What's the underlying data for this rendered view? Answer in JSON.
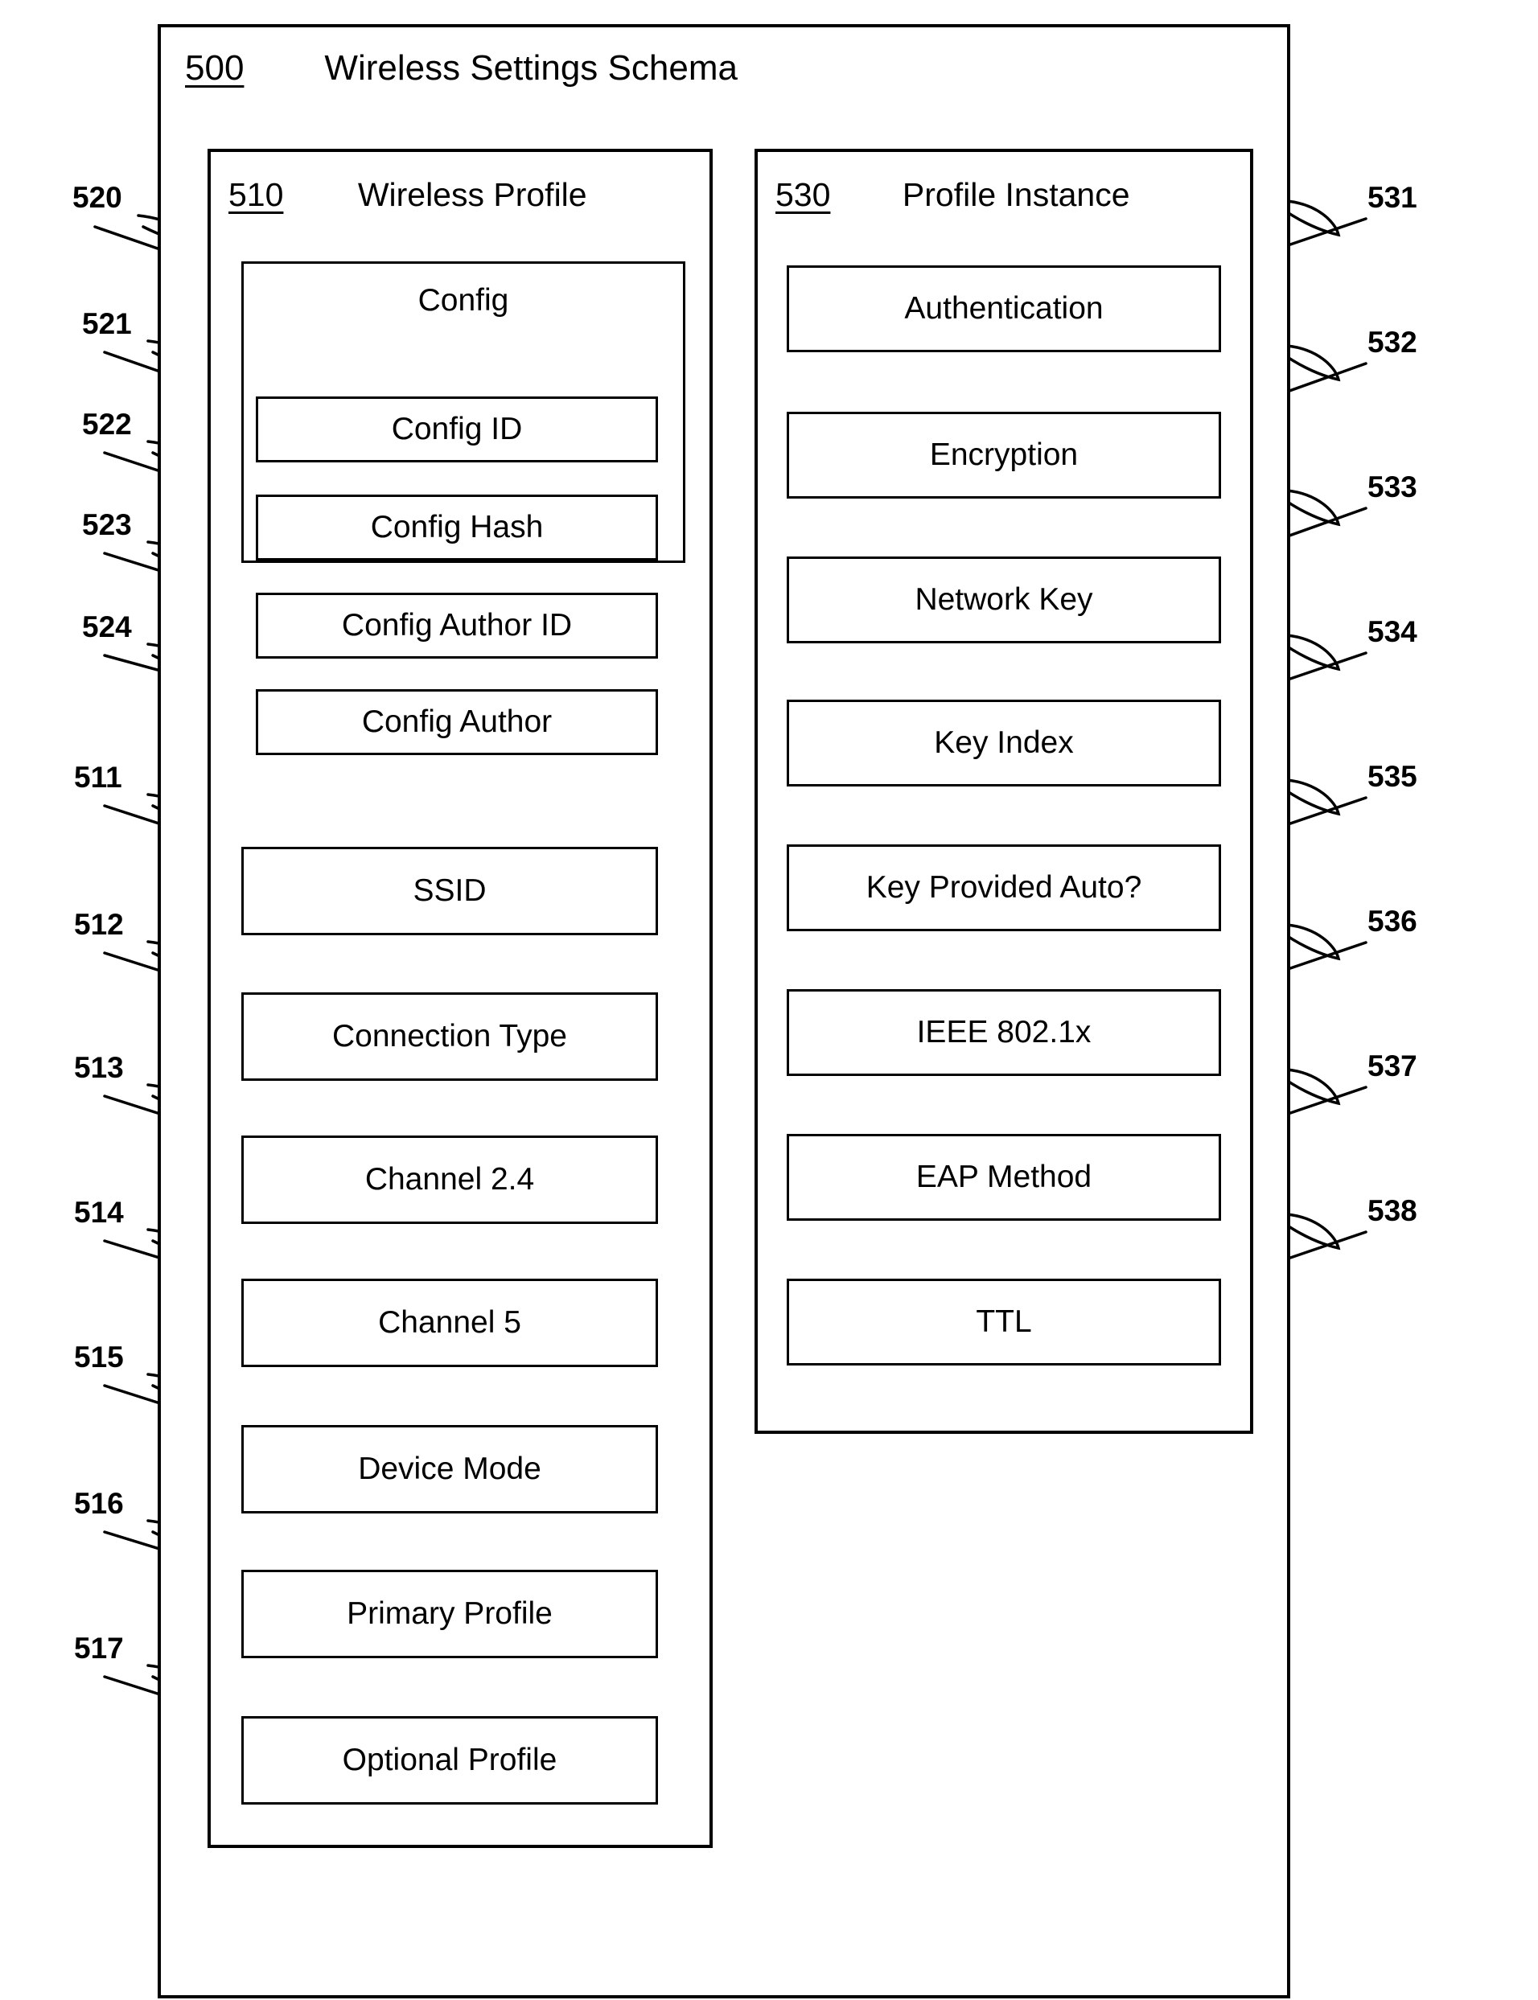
{
  "figure": {
    "ref": "500",
    "title": "Wireless Settings Schema"
  },
  "panels": {
    "wireless_profile": {
      "ref": "510",
      "title": "Wireless Profile",
      "config_group": {
        "ref": "520",
        "label": "Config",
        "children": [
          {
            "ref": "521",
            "label": "Config ID"
          },
          {
            "ref": "522",
            "label": "Config Hash"
          },
          {
            "ref": "523",
            "label": "Config Author ID"
          },
          {
            "ref": "524",
            "label": "Config Author"
          }
        ]
      },
      "fields": [
        {
          "ref": "511",
          "label": "SSID"
        },
        {
          "ref": "512",
          "label": "Connection Type"
        },
        {
          "ref": "513",
          "label": "Channel 2.4"
        },
        {
          "ref": "514",
          "label": "Channel 5"
        },
        {
          "ref": "515",
          "label": "Device Mode"
        },
        {
          "ref": "516",
          "label": "Primary Profile"
        },
        {
          "ref": "517",
          "label": "Optional Profile"
        }
      ]
    },
    "profile_instance": {
      "ref": "530",
      "title": "Profile Instance",
      "fields": [
        {
          "ref": "531",
          "label": "Authentication"
        },
        {
          "ref": "532",
          "label": "Encryption"
        },
        {
          "ref": "533",
          "label": "Network Key"
        },
        {
          "ref": "534",
          "label": "Key Index"
        },
        {
          "ref": "535",
          "label": "Key Provided Auto?"
        },
        {
          "ref": "536",
          "label": "IEEE 802.1x"
        },
        {
          "ref": "537",
          "label": "EAP Method"
        },
        {
          "ref": "538",
          "label": "TTL"
        }
      ]
    }
  },
  "colors": {
    "ink": "#000000",
    "paper": "#ffffff"
  }
}
